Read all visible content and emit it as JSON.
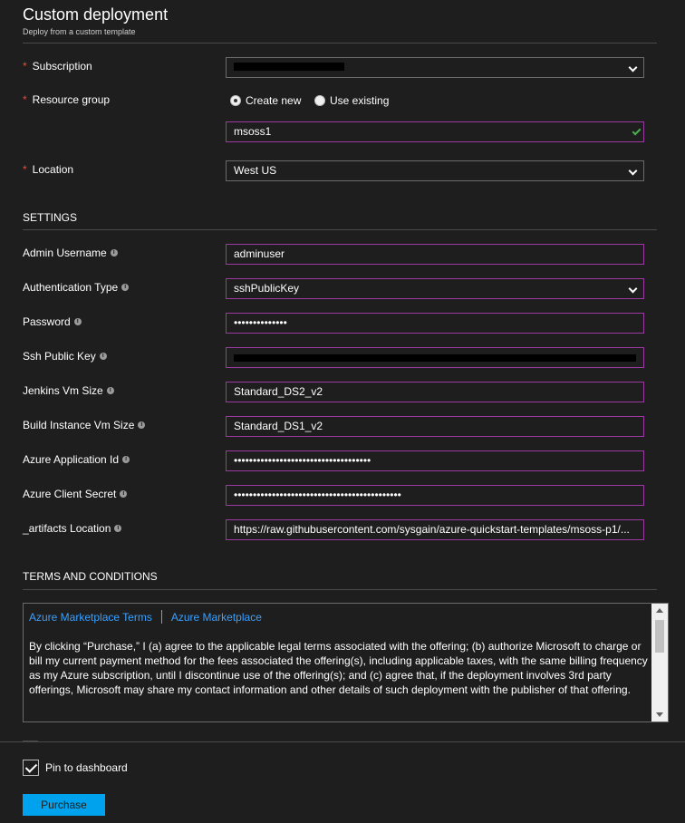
{
  "header": {
    "title": "Custom deployment",
    "subtitle": "Deploy from a custom template"
  },
  "basics": {
    "subscription": {
      "label": "Subscription",
      "required": true
    },
    "resource_group": {
      "label": "Resource group",
      "required": true,
      "create_new_label": "Create new",
      "use_existing_label": "Use existing",
      "selected": "Create new",
      "value": "msoss1"
    },
    "location": {
      "label": "Location",
      "required": true,
      "value": "West US"
    }
  },
  "settings": {
    "heading": "SETTINGS",
    "admin_username": {
      "label": "Admin Username",
      "value": "adminuser"
    },
    "authentication_type": {
      "label": "Authentication Type",
      "value": "sshPublicKey"
    },
    "password": {
      "label": "Password",
      "value": "••••••••••••••"
    },
    "ssh_public_key": {
      "label": "Ssh Public Key"
    },
    "jenkins_vm_size": {
      "label": "Jenkins Vm Size",
      "value": "Standard_DS2_v2"
    },
    "build_instance_vm_size": {
      "label": "Build Instance Vm Size",
      "value": "Standard_DS1_v2"
    },
    "azure_application_id": {
      "label": "Azure Application Id",
      "value": "••••••••••••••••••••••••••••••••••••"
    },
    "azure_client_secret": {
      "label": "Azure Client Secret",
      "value": "••••••••••••••••••••••••••••••••••••••••••••"
    },
    "artifacts_location": {
      "label": "_artifacts Location",
      "value": "https://raw.githubusercontent.com/sysgain/azure-quickstart-templates/msoss-p1/..."
    }
  },
  "terms": {
    "heading": "TERMS AND CONDITIONS",
    "link1": "Azure Marketplace Terms",
    "link2": "Azure Marketplace",
    "body": "By clicking “Purchase,” I (a) agree to the applicable legal terms associated with the offering; (b) authorize Microsoft to charge or bill my current payment method for the fees associated the offering(s), including applicable taxes, with the same billing frequency as my Azure subscription, until I discontinue use of the offering(s); and (c) agree that, if the deployment involves 3rd party offerings, Microsoft may share my contact information and other details of such deployment with the publisher of that offering."
  },
  "footer": {
    "pin_label": "Pin to dashboard",
    "pin_checked": true,
    "purchase_label": "Purchase"
  },
  "colors": {
    "background": "#1e1e1e",
    "field_border": "#9b3aa0",
    "link": "#3aa0ff",
    "required": "#e74c3c",
    "valid": "#4caf50",
    "primary_button": "#00a2ed"
  }
}
